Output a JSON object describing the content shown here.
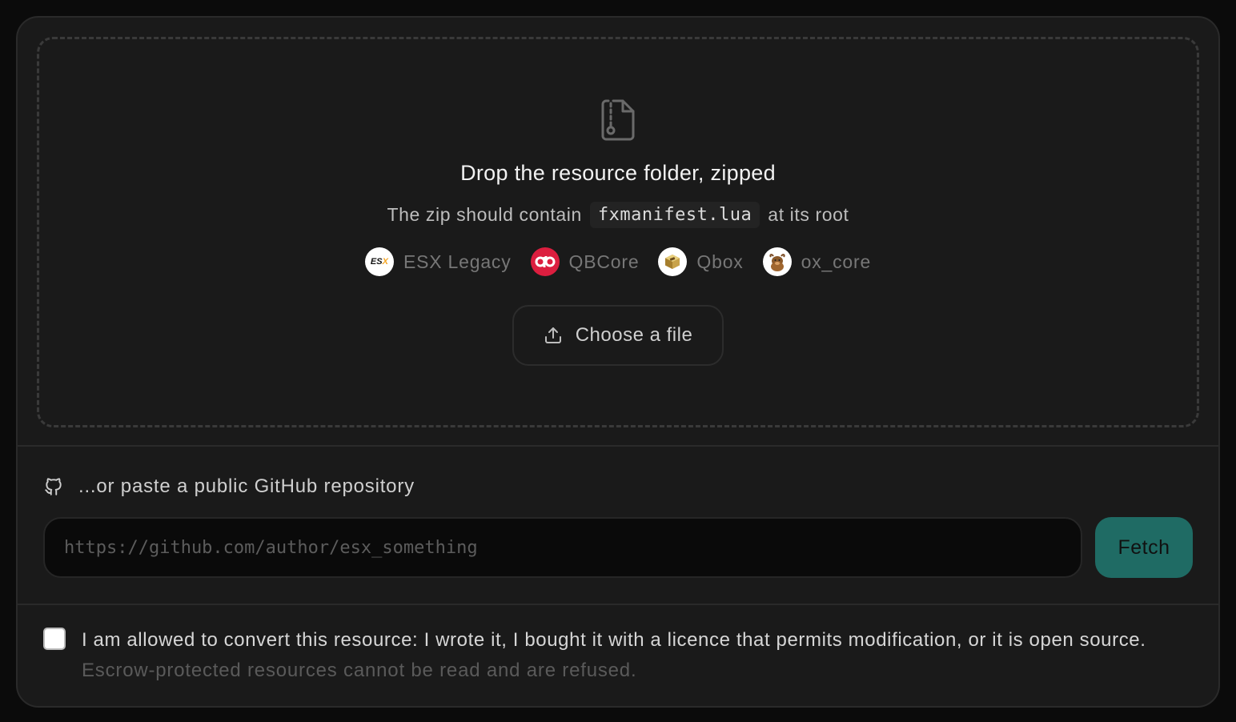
{
  "dropzone": {
    "icon": "zip-file-icon",
    "title": "Drop the resource folder, zipped",
    "subtitle_before": "The zip should contain",
    "subtitle_code": "fxmanifest.lua",
    "subtitle_after": "at its root",
    "frameworks": [
      {
        "label": "ESX Legacy",
        "icon": "esx-logo-icon"
      },
      {
        "label": "QBCore",
        "icon": "qbcore-logo-icon"
      },
      {
        "label": "Qbox",
        "icon": "qbox-logo-icon"
      },
      {
        "label": "ox_core",
        "icon": "ox-core-logo-icon"
      }
    ],
    "choose_button": "Choose a file",
    "choose_icon": "upload-icon"
  },
  "github": {
    "icon": "github-icon",
    "label": "...or paste a public GitHub repository",
    "placeholder": "https://github.com/author/esx_something",
    "value": "",
    "fetch_label": "Fetch"
  },
  "consent": {
    "checked": false,
    "text": "I am allowed to convert this resource: I wrote it, I bought it with a licence that permits modification, or it is open source.",
    "note": "Escrow-protected resources cannot be read and are refused."
  },
  "colors": {
    "background": "#1a1a1a",
    "accent": "#1f6b64",
    "qbcore_red": "#dc1e3f"
  }
}
